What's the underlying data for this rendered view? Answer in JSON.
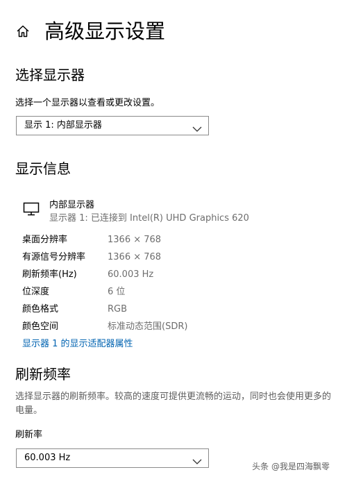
{
  "header": {
    "title": "高级显示设置",
    "home_icon": "home-icon"
  },
  "select_display": {
    "heading": "选择显示器",
    "description": "选择一个显示器以查看或更改设置。",
    "dropdown_value": "显示 1: 内部显示器"
  },
  "display_info": {
    "heading": "显示信息",
    "monitor_icon": "monitor-icon",
    "display_name": "内部显示器",
    "display_sub": "显示器 1: 已连接到 Intel(R) UHD Graphics 620",
    "rows": [
      {
        "key": "桌面分辨率",
        "value": "1366 × 768"
      },
      {
        "key": "有源信号分辨率",
        "value": "1366 × 768"
      },
      {
        "key": "刷新频率(Hz)",
        "value": "60.003 Hz"
      },
      {
        "key": "位深度",
        "value": "6 位"
      },
      {
        "key": "颜色格式",
        "value": "RGB"
      },
      {
        "key": "颜色空间",
        "value": "标准动态范围(SDR)"
      }
    ],
    "adapter_link": "显示器 1 的显示适配器属性"
  },
  "refresh_rate": {
    "heading": "刷新频率",
    "description": "选择显示器的刷新频率。较高的速度可提供更流畅的运动，同时也会使用更多的电量。",
    "label": "刷新率",
    "dropdown_value": "60.003 Hz"
  },
  "watermark": "头条 @我是四海飘零",
  "colors": {
    "link": "#0063b1",
    "secondary_text": "#6d6d6d",
    "border": "#8a8a8a"
  }
}
